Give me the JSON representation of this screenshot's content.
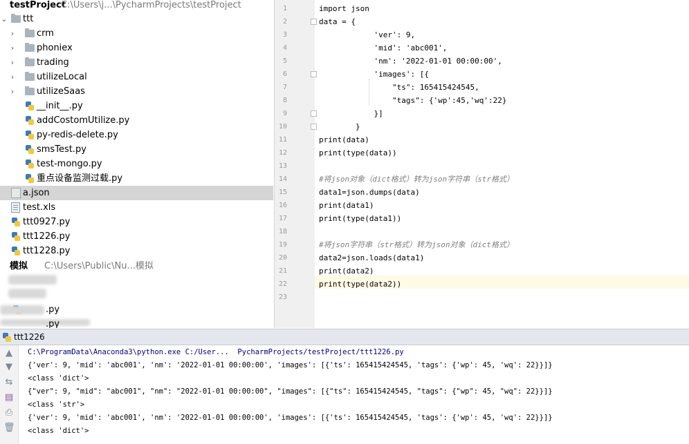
{
  "project": {
    "root_name": "testProject",
    "root_path": "C:\\Users\\j...\\PycharmProjects\\testProject",
    "items": [
      {
        "label": "ttt",
        "kind": "folder",
        "indent": 0,
        "expanded": true
      },
      {
        "label": "crm",
        "kind": "folder",
        "indent": 1
      },
      {
        "label": "phoniex",
        "kind": "folder",
        "indent": 1
      },
      {
        "label": "trading",
        "kind": "folder",
        "indent": 1
      },
      {
        "label": "utilizeLocal",
        "kind": "folder",
        "indent": 1
      },
      {
        "label": "utilizeSaas",
        "kind": "folder",
        "indent": 1
      },
      {
        "label": "__init__.py",
        "kind": "py",
        "indent": 1
      },
      {
        "label": "addCostomUtilize.py",
        "kind": "py",
        "indent": 1
      },
      {
        "label": "py-redis-delete.py",
        "kind": "py",
        "indent": 1
      },
      {
        "label": "smsTest.py",
        "kind": "py",
        "indent": 1
      },
      {
        "label": "test-mongo.py",
        "kind": "py",
        "indent": 1
      },
      {
        "label": "重点设备监测过载.py",
        "kind": "py",
        "indent": 1
      },
      {
        "label": "a.json",
        "kind": "json",
        "indent": 0,
        "selected": true
      },
      {
        "label": "test.xls",
        "kind": "xls",
        "indent": 0
      },
      {
        "label": "ttt0927.py",
        "kind": "py",
        "indent": 0
      },
      {
        "label": "ttt1226.py",
        "kind": "py",
        "indent": 0
      },
      {
        "label": "ttt1228.py",
        "kind": "py",
        "indent": 0
      }
    ],
    "second_root_name": "模拟",
    "second_root_path": "C:\\Users\\Public\\Nu...模拟",
    "blurred_items": [
      ".py",
      ".py"
    ]
  },
  "editor": {
    "line_numbers": [
      "1",
      "2",
      "3",
      "4",
      "5",
      "6",
      "7",
      "8",
      "9",
      "10",
      "11",
      "12",
      "13",
      "14",
      "15",
      "16",
      "17",
      "18",
      "19",
      "20",
      "21",
      "22",
      "23"
    ],
    "lines": [
      "import json",
      "data = {",
      "            'ver': 9,",
      "            'mid': 'abc001',",
      "            'nm': '2022-01-01 00:00:00',",
      "            'images': [{",
      "                \"ts\": 165415424545,",
      "                \"tags\": {'wp':45,'wq':22}",
      "            }]",
      "        }",
      "print(data)",
      "print(type(data))",
      "",
      "#将json对象（dict格式）转为json字符串（str格式）",
      "data1=json.dumps(data)",
      "print(data1)",
      "print(type(data1))",
      "",
      "#将json字符串（str格式）转为json对象（dict格式）",
      "data2=json.loads(data1)",
      "print(data2)",
      "print(type(data2))",
      ""
    ],
    "current_line": 22
  },
  "run": {
    "tab_label": "ttt1226",
    "output": [
      "C:\\ProgramData\\Anaconda3\\python.exe C:/User...  PycharmProjects/testProject/ttt1226.py",
      "{'ver': 9, 'mid': 'abc001', 'nm': '2022-01-01 00:00:00', 'images': [{'ts': 165415424545, 'tags': {'wp': 45, 'wq': 22}}]}",
      "<class 'dict'>",
      "{\"ver\": 9, \"mid\": \"abc001\", \"nm\": \"2022-01-01 00:00:00\", \"images\": [{\"ts\": 165415424545, \"tags\": {\"wp\": 45, \"wq\": 22}}]}",
      "<class 'str'>",
      "{'ver': 9, 'mid': 'abc001', 'nm': '2022-01-01 00:00:00', 'images': [{'ts': 165415424545, 'tags': {'wp': 45, 'wq': 22}}]}",
      "<class 'dict'>"
    ],
    "tools": [
      "arrow-up-icon",
      "arrow-down-icon",
      "soft-wrap-icon",
      "scroll-to-end-icon",
      "print-icon",
      "trash-icon"
    ]
  }
}
